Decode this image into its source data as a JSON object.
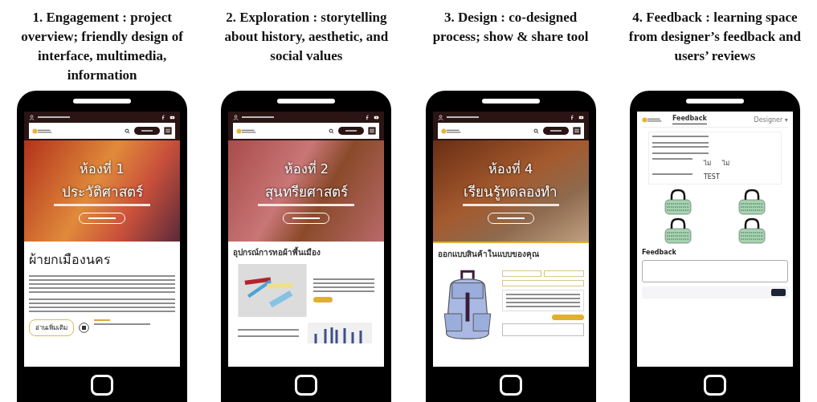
{
  "panels": [
    {
      "caption": "1. Engagement : project overview; friendly design of interface, multimedia, information",
      "kind": "article",
      "hero": {
        "room": "ห้องที่ 1",
        "title": "ประวัติศาสตร์"
      },
      "heading": "ผ้ายกเมืองนคร",
      "button": "อ่านเพิ่มเติม"
    },
    {
      "caption": "2. Exploration : storytelling about history, aesthetic, and social values",
      "kind": "gallery",
      "hero": {
        "room": "ห้องที่ 2",
        "title": "สุนทรียศาสตร์"
      },
      "heading": "อุปกรณ์การทอผ้าพื้นเมือง"
    },
    {
      "caption": "3. Design : co-designed process; show & share tool",
      "kind": "designer",
      "hero": {
        "room": "ห้องที่ 4",
        "title": "เรียนรู้ทดลองทำ"
      },
      "heading": "ออกแบบสินค้าในแบบของคุณ"
    },
    {
      "caption": "4. Feedback : learning space from designer’s feedback and users’ reviews",
      "kind": "feedback",
      "tabs": [
        {
          "label": "Feedback",
          "selected": true
        }
      ],
      "user": "Designer ▾",
      "answers": [
        "ไม่",
        "ไม่"
      ],
      "test": "TEST",
      "field_label": "Feedback"
    }
  ]
}
